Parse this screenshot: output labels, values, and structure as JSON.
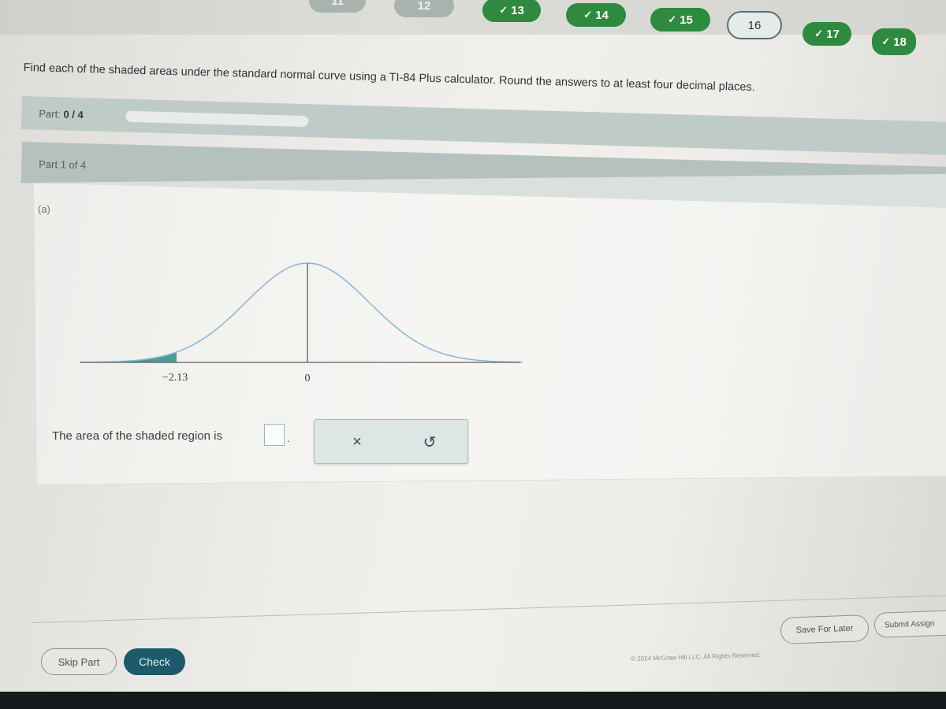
{
  "nav": {
    "questions": [
      {
        "num": "11",
        "status": "muted"
      },
      {
        "num": "12",
        "status": "muted"
      },
      {
        "num": "13",
        "status": "done"
      },
      {
        "num": "14",
        "status": "done"
      },
      {
        "num": "15",
        "status": "done"
      },
      {
        "num": "16",
        "status": "current"
      },
      {
        "num": "17",
        "status": "done"
      },
      {
        "num": "18",
        "status": "done"
      }
    ],
    "check_glyph": "✓"
  },
  "instructions": "Find each of the shaded areas under the standard normal curve using a TI-84 Plus calculator. Round the answers to at least four decimal places.",
  "part_progress": {
    "label": "Part:",
    "value": "0 / 4",
    "progress_fraction": 0
  },
  "part_current": "Part 1 of 4",
  "part_letter": "(a)",
  "figure": {
    "left_tick": "−2.13",
    "center_tick": "0",
    "shaded_boundary": -2.13,
    "shade_color": "#4e9b94",
    "curve_color": "#8ab4dc"
  },
  "answer": {
    "prompt": "The area of the shaded region is",
    "period": "."
  },
  "tools": {
    "clear_symbol": "×",
    "undo_symbol": "↺"
  },
  "actions": {
    "skip": "Skip Part",
    "check": "Check",
    "save": "Save For Later",
    "submit": "Submit Assign"
  },
  "footer": "© 2024 McGraw Hill LLC. All Rights Reserved.",
  "colors": {
    "accent_green": "#2d8a3e",
    "check_button": "#1d5a6b"
  }
}
